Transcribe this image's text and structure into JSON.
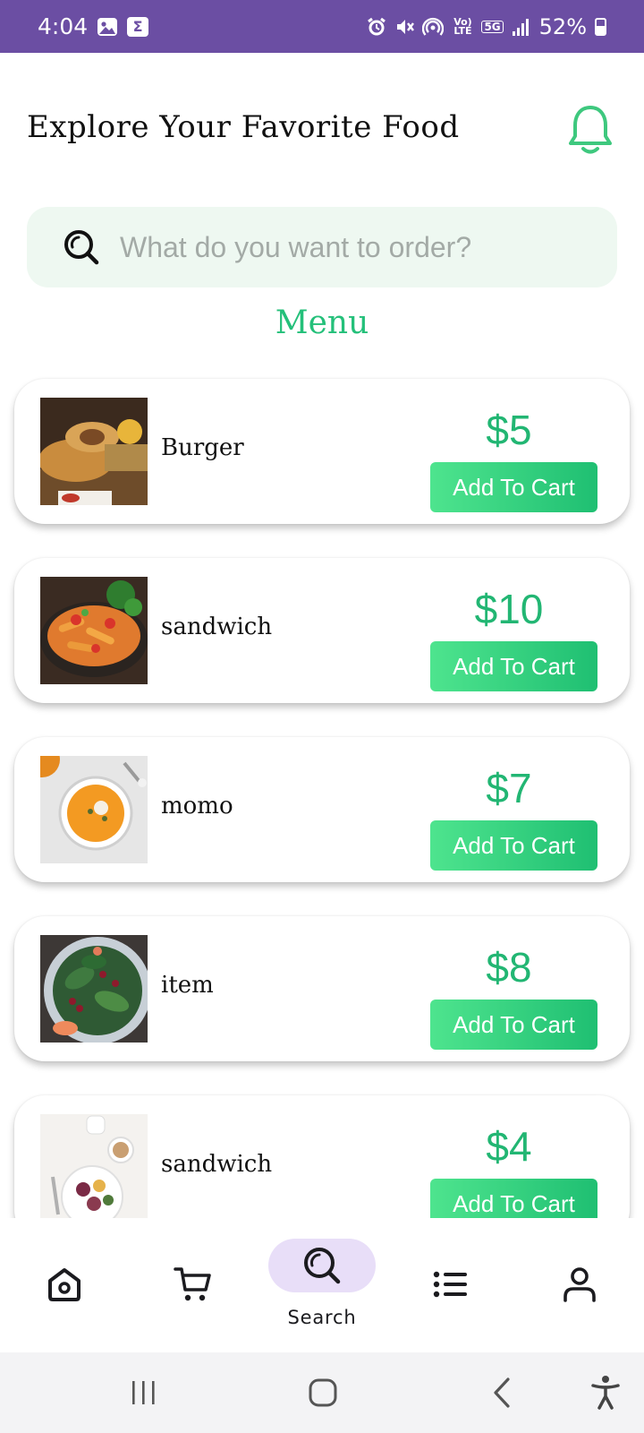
{
  "status_bar": {
    "time": "4:04",
    "volte_label": "Vo) LTE",
    "network_label": "5G",
    "battery_percent": "52%",
    "background_color": "#6b4ea3"
  },
  "header": {
    "title": "Explore Your Favorite Food",
    "bell_icon": "bell-icon"
  },
  "search": {
    "placeholder": "What do you want to order?",
    "value": "",
    "icon": "search-icon"
  },
  "menu": {
    "title": "Menu",
    "button_label": "Add To Cart",
    "items": [
      {
        "name": "Burger",
        "price": "$5",
        "image": "wraps-photo"
      },
      {
        "name": "sandwich",
        "price": "$10",
        "image": "pasta-photo"
      },
      {
        "name": "momo",
        "price": "$7",
        "image": "soup-photo"
      },
      {
        "name": "item",
        "price": "$8",
        "image": "salad-photo"
      },
      {
        "name": "sandwich",
        "price": "$4",
        "image": "breakfast-photo"
      }
    ]
  },
  "bottom_nav": {
    "items": [
      {
        "icon": "home-icon",
        "label": ""
      },
      {
        "icon": "cart-icon",
        "label": ""
      },
      {
        "icon": "search-icon",
        "label": "Search",
        "active": true
      },
      {
        "icon": "list-icon",
        "label": ""
      },
      {
        "icon": "profile-icon",
        "label": ""
      }
    ]
  },
  "colors": {
    "accent": "#24c07a",
    "button_start": "#4ee48e",
    "button_end": "#1fbf72",
    "active_pill": "#e8def8",
    "search_bg": "#eef8f1"
  }
}
